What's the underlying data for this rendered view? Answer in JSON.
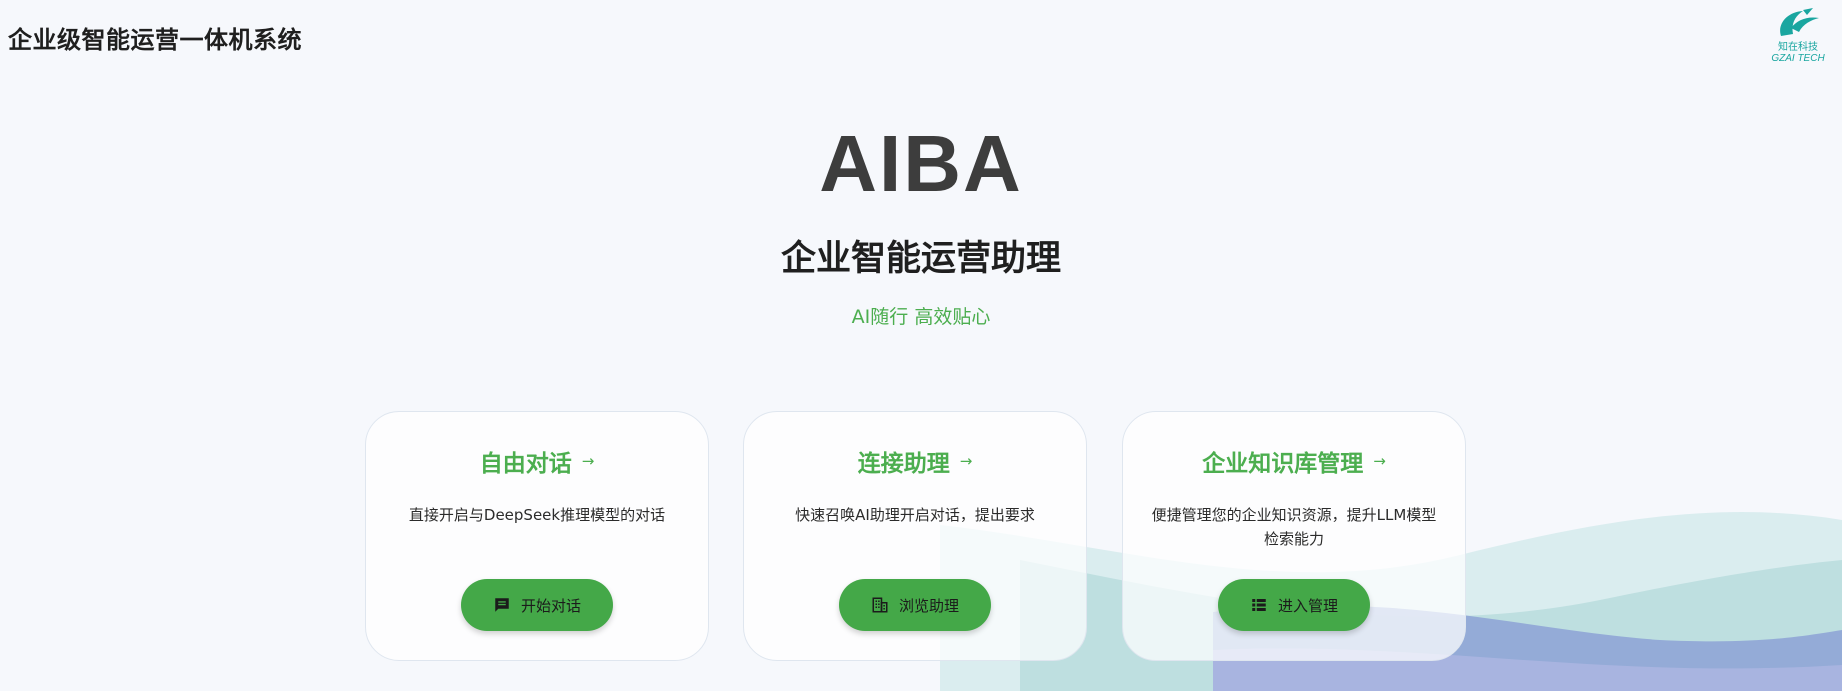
{
  "header": {
    "app_title": "企业级智能运营一体机系统"
  },
  "logo": {
    "cn": "知在科技",
    "en": "GZAI TECH"
  },
  "hero": {
    "title": "AIBA",
    "subtitle": "企业智能运营助理",
    "slogan": "AI随行 高效贴心"
  },
  "cards": [
    {
      "title": "自由对话",
      "arrow": "→",
      "description": "直接开启与DeepSeek推理模型的对话",
      "button": "开始对话",
      "icon": "chat-icon"
    },
    {
      "title": "连接助理",
      "arrow": "→",
      "description": "快速召唤AI助理开启对话，提出要求",
      "button": "浏览助理",
      "icon": "building-icon"
    },
    {
      "title": "企业知识库管理",
      "arrow": "→",
      "description": "便捷管理您的企业知识资源，提升LLM模型检索能力",
      "button": "进入管理",
      "icon": "list-icon"
    }
  ],
  "colors": {
    "accent": "#4cae4f",
    "button": "#44a848",
    "background": "#f6f8fc",
    "wave_teal": "#a9d8d8",
    "wave_blue": "#8ea6d8"
  }
}
